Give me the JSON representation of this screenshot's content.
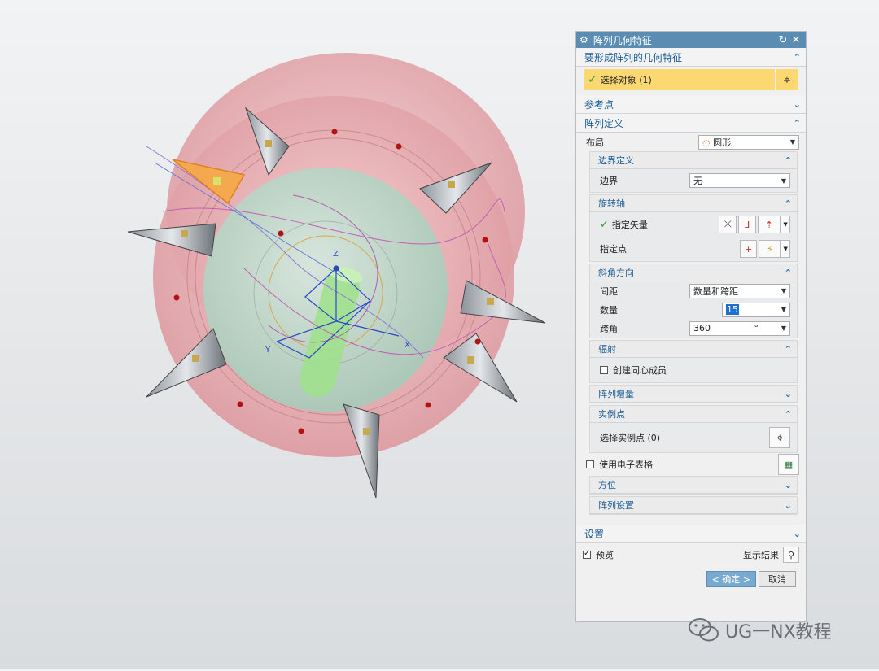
{
  "colors": {
    "title_bar": "#5b8db3",
    "section_header": "#1c5d94",
    "selection_highlight": "#fcd873",
    "accent_orange": "#f4a53a"
  },
  "dialog": {
    "title": "阵列几何特征",
    "sections": {
      "geometry": {
        "title": "要形成阵列的几何特征",
        "select_label": "选择对象 (1)"
      },
      "reference": {
        "title": "参考点"
      },
      "pattern_def": {
        "title": "阵列定义",
        "layout_label": "布局",
        "layout_value": "圆形",
        "boundary": {
          "title": "边界定义",
          "label": "边界",
          "value": "无"
        },
        "axis": {
          "title": "旋转轴",
          "vector_label": "指定矢量",
          "point_label": "指定点"
        },
        "angular": {
          "title": "斜角方向",
          "spacing_label": "间距",
          "spacing_value": "数量和跨距",
          "count_label": "数量",
          "count_value": "15",
          "span_label": "跨角",
          "span_value": "360",
          "span_unit": "°"
        },
        "radiate": {
          "title": "辐射",
          "concentric_label": "创建同心成员"
        },
        "increment": {
          "title": "阵列增量"
        },
        "instance": {
          "title": "实例点",
          "select_label": "选择实例点 (0)"
        },
        "spreadsheet_label": "使用电子表格",
        "orientation": {
          "title": "方位"
        },
        "settings_sub": {
          "title": "阵列设置"
        }
      },
      "settings": {
        "title": "设置"
      }
    },
    "preview_label": "预览",
    "show_result_label": "显示结果",
    "ok_label": "< 确定 >",
    "cancel_label": "取消"
  },
  "viewport": {
    "axis_labels": {
      "z": "Z",
      "x": "X",
      "y": "Y"
    }
  },
  "watermark": {
    "text": "UG一NX教程"
  }
}
